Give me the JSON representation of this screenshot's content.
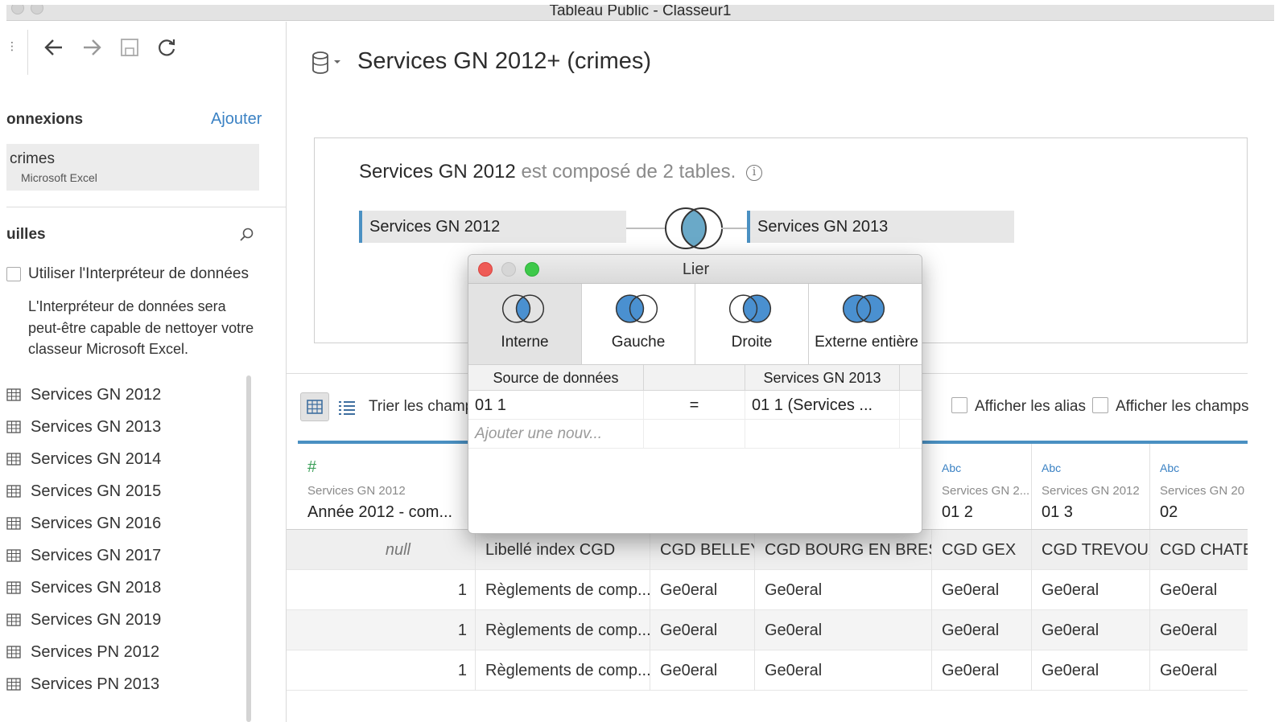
{
  "window": {
    "title": "Tableau Public - Classeur1"
  },
  "sidebar": {
    "connections_title": "onnexions",
    "add_label": "Ajouter",
    "connection": {
      "name": "crimes",
      "type": "Microsoft Excel"
    },
    "sheets_title": "uilles",
    "interpreter": {
      "label": "Utiliser l'Interpréteur de données",
      "description": "L'Interpréteur de données sera peut-être capable de nettoyer votre classeur Microsoft Excel."
    },
    "sheets": [
      "Services GN 2012",
      "Services GN 2013",
      "Services GN 2014",
      "Services GN 2015",
      "Services GN 2016",
      "Services GN 2017",
      "Services GN 2018",
      "Services GN 2019",
      "Services PN 2012",
      "Services PN 2013"
    ]
  },
  "main": {
    "datasource_title": "Services GN 2012+ (crimes)",
    "composed": {
      "name": "Services GN 2012",
      "rest": "est composé de 2 tables.",
      "info_icon": "i"
    },
    "left_table": "Services GN 2012",
    "right_table": "Services GN 2013",
    "sort_label": "Trier les champs",
    "show_alias_label": "Afficher les alias",
    "show_fields_label": "Afficher les champs"
  },
  "grid": {
    "columns": [
      {
        "type": "#",
        "source": "Services GN 2012",
        "name": "Année 2012 - com..."
      },
      {
        "type": "Abc",
        "source": "",
        "name": ""
      },
      {
        "type": "Abc",
        "source": "",
        "name": ""
      },
      {
        "type": "Abc",
        "source": "",
        "name": ""
      },
      {
        "type": "Abc",
        "source": "Services GN 2...",
        "name": "01 2"
      },
      {
        "type": "Abc",
        "source": "Services GN 2012",
        "name": "01 3"
      },
      {
        "type": "Abc",
        "source": "Services GN 20",
        "name": "02"
      }
    ],
    "rows": [
      [
        "null",
        "Libellé index CGD",
        "CGD BELLEY",
        "CGD BOURG EN BRES...",
        "CGD GEX",
        "CGD TREVOUX",
        "CGD CHATE"
      ],
      [
        "1",
        "Règlements de comp...",
        "Ge0eral",
        "Ge0eral",
        "Ge0eral",
        "Ge0eral",
        "Ge0eral"
      ],
      [
        "1",
        "Règlements de comp...",
        "Ge0eral",
        "Ge0eral",
        "Ge0eral",
        "Ge0eral",
        "Ge0eral"
      ],
      [
        "1",
        "Règlements de comp...",
        "Ge0eral",
        "Ge0eral",
        "Ge0eral",
        "Ge0eral",
        "Ge0eral"
      ]
    ]
  },
  "join_dialog": {
    "title": "Lier",
    "types": [
      {
        "label": "Interne",
        "icon": "inner-join-icon",
        "selected": true
      },
      {
        "label": "Gauche",
        "icon": "left-join-icon",
        "selected": false
      },
      {
        "label": "Droite",
        "icon": "right-join-icon",
        "selected": false
      },
      {
        "label": "Externe entière",
        "icon": "full-outer-join-icon",
        "selected": false
      }
    ],
    "clause_headers": {
      "left": "Source de données",
      "operator": "",
      "right": "Services GN 2013"
    },
    "clause": {
      "left": "01 1",
      "operator": "=",
      "right": "01 1 (Services ..."
    },
    "add_placeholder": "Ajouter une nouv..."
  },
  "colors": {
    "accent": "#4a90c2",
    "link": "#3b82c4",
    "venn_fill": "#4a90d0",
    "close": "#ee5b56",
    "maximize": "#3ec94a"
  }
}
